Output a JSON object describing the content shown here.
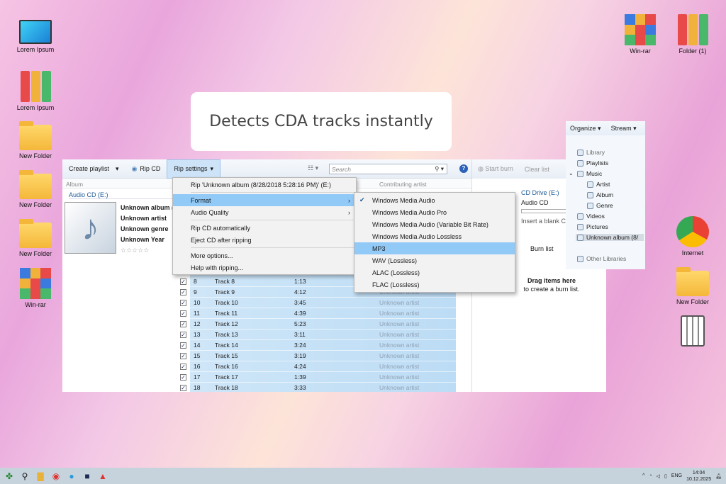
{
  "headline": "Detects CDA tracks instantly",
  "desktop": {
    "left": [
      {
        "label": "Lorem Ipsum",
        "icon": "monitor-icon"
      },
      {
        "label": "Lorem Ipsum",
        "icon": "binders-icon"
      },
      {
        "label": "New Folder",
        "icon": "folder-icon"
      },
      {
        "label": "New Folder",
        "icon": "folder-icon"
      },
      {
        "label": "New Folder",
        "icon": "folder-icon"
      },
      {
        "label": "Win-rar",
        "icon": "winrar-icon"
      }
    ],
    "right": [
      {
        "label": "Win-rar",
        "icon": "winrar-icon"
      },
      {
        "label": "Folder (1)",
        "icon": "binders-icon"
      },
      {
        "label": "Internet",
        "icon": "chrome-icon"
      },
      {
        "label": "New Folder",
        "icon": "folder-icon"
      },
      {
        "label": "",
        "icon": "recycle-bin-icon"
      }
    ]
  },
  "toolbar": {
    "create_playlist": "Create playlist",
    "rip_cd": "Rip CD",
    "rip_settings": "Rip settings",
    "search_placeholder": "Search",
    "start_burn": "Start burn",
    "clear_list": "Clear list"
  },
  "columns": {
    "album": "Album",
    "contributing_artist": "Contributing artist"
  },
  "album": {
    "source": "Audio CD (E:)",
    "title": "Unknown album (",
    "artist": "Unknown artist",
    "genre": "Unknown genre",
    "year": "Unknown Year",
    "rating": "☆☆☆☆☆"
  },
  "tracks": [
    {
      "n": "8",
      "title": "Track 8",
      "length": "1:13",
      "artist": ""
    },
    {
      "n": "9",
      "title": "Track 9",
      "length": "4:12",
      "artist": "Unknown artist"
    },
    {
      "n": "10",
      "title": "Track 10",
      "length": "3:45",
      "artist": "Unknown artist"
    },
    {
      "n": "11",
      "title": "Track 11",
      "length": "4:39",
      "artist": "Unknown artist"
    },
    {
      "n": "12",
      "title": "Track 12",
      "length": "5:23",
      "artist": "Unknown artist"
    },
    {
      "n": "13",
      "title": "Track 13",
      "length": "3:11",
      "artist": "Unknown artist"
    },
    {
      "n": "14",
      "title": "Track 14",
      "length": "3:24",
      "artist": "Unknown artist"
    },
    {
      "n": "15",
      "title": "Track 15",
      "length": "3:19",
      "artist": "Unknown artist"
    },
    {
      "n": "16",
      "title": "Track 16",
      "length": "4:24",
      "artist": "Unknown artist"
    },
    {
      "n": "17",
      "title": "Track 17",
      "length": "1:39",
      "artist": "Unknown artist"
    },
    {
      "n": "18",
      "title": "Track 18",
      "length": "3:33",
      "artist": "Unknown artist"
    }
  ],
  "rip_menu": [
    {
      "label": "Rip 'Unknown album (8/28/2018 5:28:16 PM)' (E:)"
    },
    {
      "sep": true
    },
    {
      "label": "Format",
      "submenu": true,
      "highlight": true
    },
    {
      "label": "Audio Quality",
      "submenu": true
    },
    {
      "sep": true
    },
    {
      "label": "Rip CD automatically"
    },
    {
      "label": "Eject CD after ripping"
    },
    {
      "sep": true
    },
    {
      "label": "More options..."
    },
    {
      "label": "Help with ripping..."
    }
  ],
  "format_menu": [
    {
      "label": "Windows Media Audio",
      "checked": true
    },
    {
      "label": "Windows Media Audio Pro"
    },
    {
      "label": "Windows Media Audio (Variable Bit Rate)"
    },
    {
      "label": "Windows Media Audio Lossless"
    },
    {
      "label": "MP3",
      "highlight": true
    },
    {
      "label": "WAV (Lossless)"
    },
    {
      "label": "ALAC (Lossless)"
    },
    {
      "label": "FLAC (Lossless)"
    }
  ],
  "burn": {
    "drive": "CD Drive (E:)",
    "type": "Audio CD",
    "insert": "Insert a blank CD",
    "list_title": "Burn list",
    "drag_title": "Drag items here",
    "drag_sub": "to create a burn list."
  },
  "nav": {
    "organize": "Organize",
    "stream": "Stream",
    "items": [
      "Library",
      "Playlists",
      "Music",
      "Artist",
      "Album",
      "Genre",
      "Videos",
      "Pictures",
      "Unknown album (8/",
      "Other Libraries"
    ]
  },
  "taskbar": {
    "lang": "ENG",
    "time": "14:04",
    "date": "10.12.2025"
  }
}
